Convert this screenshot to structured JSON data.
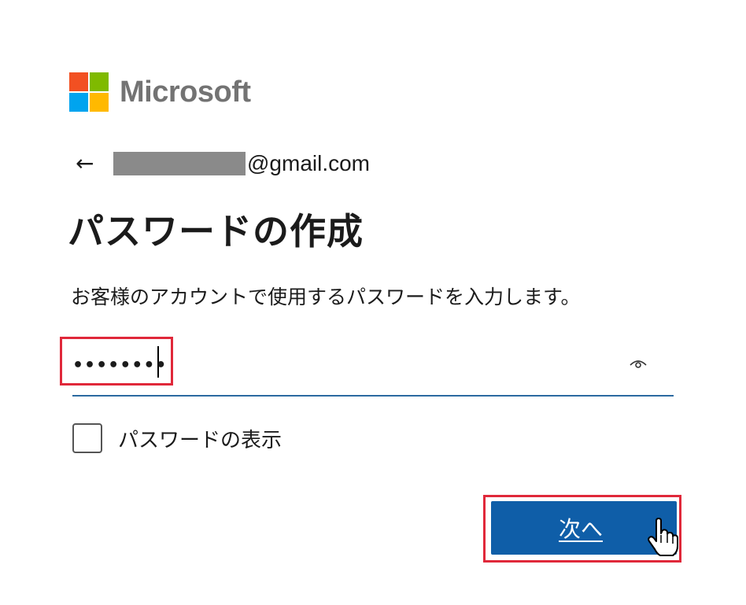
{
  "logo": {
    "text": "Microsoft",
    "colors": [
      "#f25022",
      "#7fba00",
      "#00a4ef",
      "#ffb900"
    ]
  },
  "identity": {
    "back_icon": "back-arrow-icon",
    "email_domain": "@gmail.com"
  },
  "title": "パスワードの作成",
  "description": "お客様のアカウントで使用するパスワードを入力します。",
  "password_field": {
    "value": "••••••••",
    "reveal_icon": "eye-icon"
  },
  "show_password": {
    "label": "パスワードの表示",
    "checked": false
  },
  "next_button": {
    "label": "次へ"
  },
  "colors": {
    "accent": "#0f5ea8",
    "highlight": "#e0283a"
  }
}
